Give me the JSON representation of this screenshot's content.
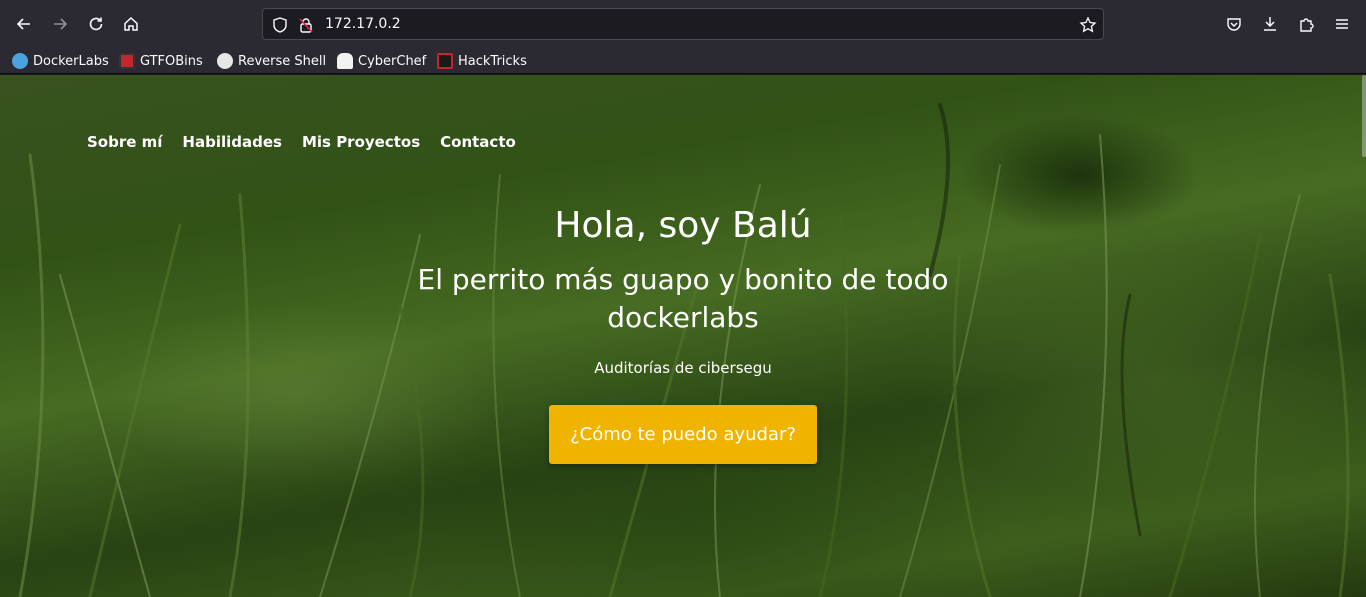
{
  "browser": {
    "url": "172.17.0.2",
    "bookmarks": [
      {
        "label": "DockerLabs",
        "icon": "dockerlabs-icon",
        "color": "#4aa3df"
      },
      {
        "label": "GTFOBins",
        "icon": "gtfobins-icon",
        "color": "#c2272d"
      },
      {
        "label": "Reverse Shell",
        "icon": "skull-icon",
        "color": "#e6e6e6"
      },
      {
        "label": "CyberChef",
        "icon": "chef-hat-icon",
        "color": "#f2f2f2"
      },
      {
        "label": "HackTricks",
        "icon": "hacktricks-icon",
        "color": "#c2272d"
      }
    ]
  },
  "page": {
    "nav": [
      "Sobre mí",
      "Habilidades",
      "Mis Proyectos",
      "Contacto"
    ],
    "title": "Hola, soy Balú",
    "subtitle": "El perrito más guapo y bonito de todo dockerlabs",
    "tagline": "Auditorías de cibersegu",
    "cta": "¿Cómo te puedo ayudar?",
    "accent": "#f0b400"
  }
}
